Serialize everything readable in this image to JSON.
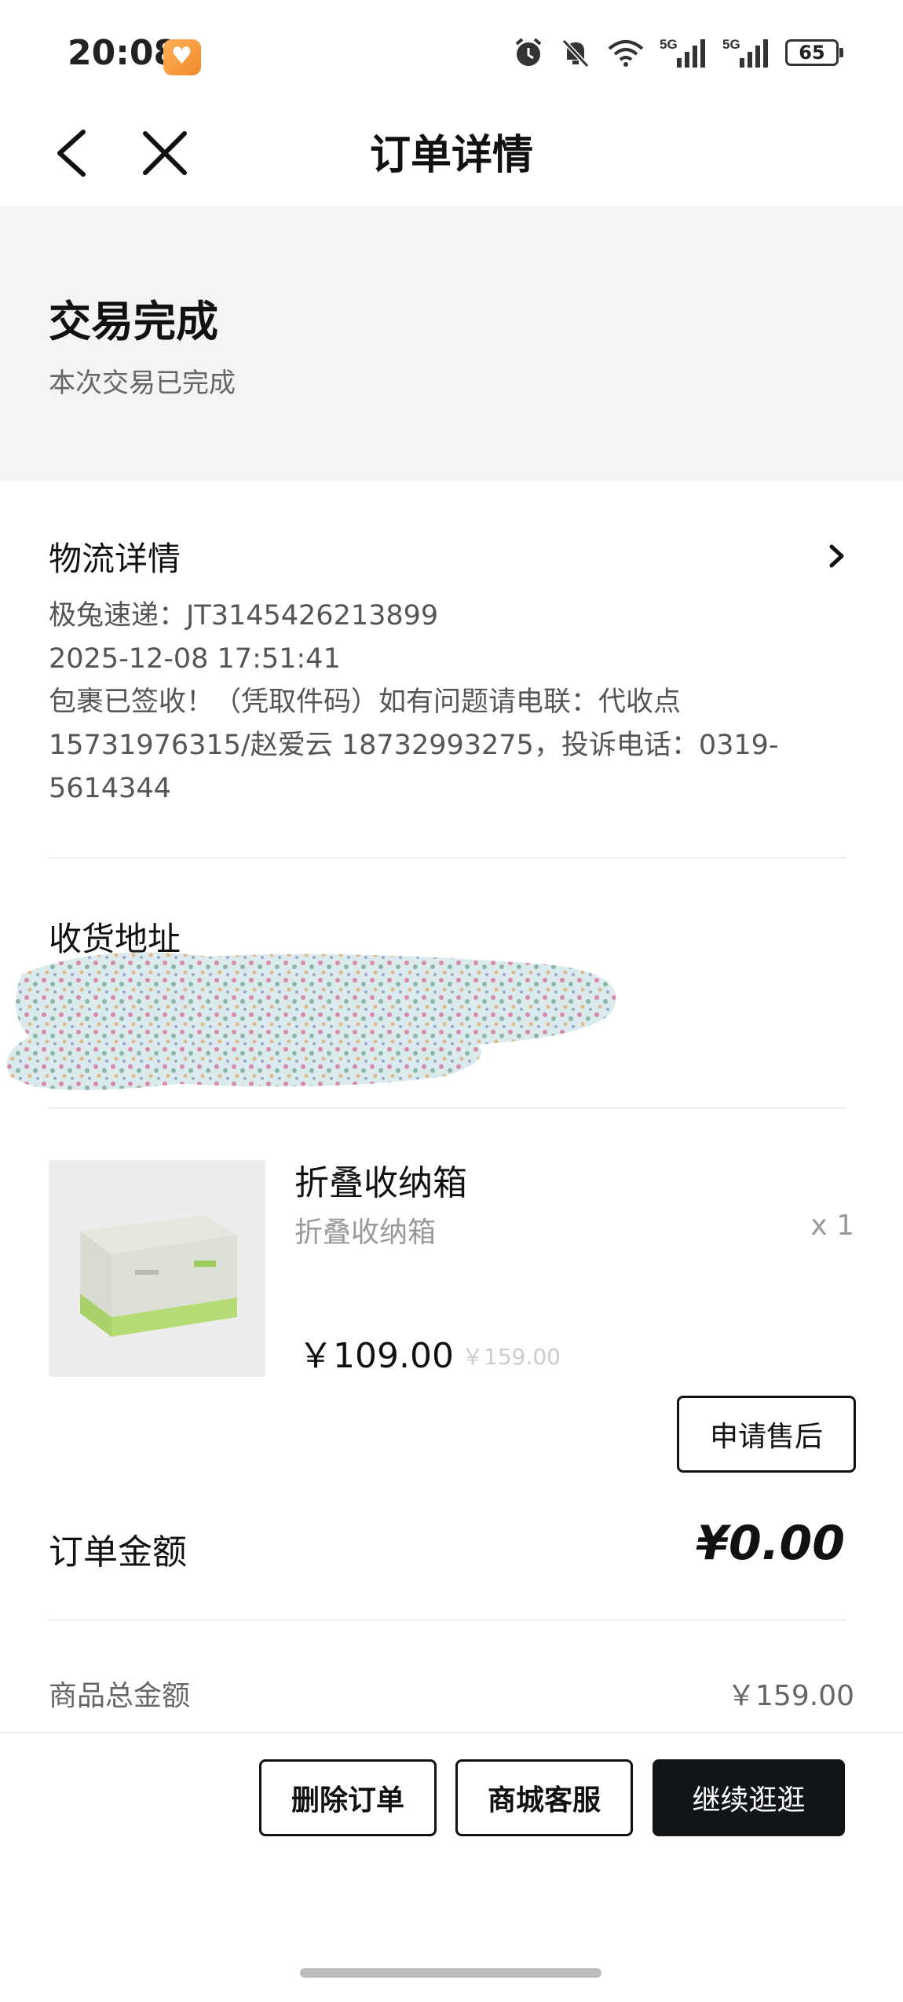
{
  "status_bar": {
    "time": "20:08",
    "battery": "65",
    "network_1": "5G",
    "network_2": "5G"
  },
  "nav": {
    "title": "订单详情"
  },
  "order_status": {
    "title": "交易完成",
    "subtitle": "本次交易已完成"
  },
  "logistics": {
    "title": "物流详情",
    "lines": [
      "极兔速递：JT3145426213899",
      "2025-12-08 17:51:41",
      "包裹已签收！（凭取件码）如有问题请电联：代收点",
      "15731976315/赵爱云 18732993275，投诉电话：0319-",
      "5614344"
    ]
  },
  "address": {
    "title": "收货地址"
  },
  "product": {
    "name": "折叠收纳箱",
    "spec": "折叠收纳箱",
    "quantity": "x 1",
    "price": "￥109.00",
    "original_price": "￥159.00",
    "after_sale_label": "申请售后"
  },
  "amounts": {
    "order_amount_label": "订单金额",
    "order_amount_value": "¥0.00",
    "goods_total_label": "商品总金额",
    "goods_total_value": "￥159.00"
  },
  "actions": {
    "delete_label": "删除订单",
    "service_label": "商城客服",
    "continue_label": "继续逛逛"
  },
  "colors": {
    "primary_button": "#111418",
    "banner_bg": "#f4f4f4",
    "muted_text": "#999999"
  }
}
